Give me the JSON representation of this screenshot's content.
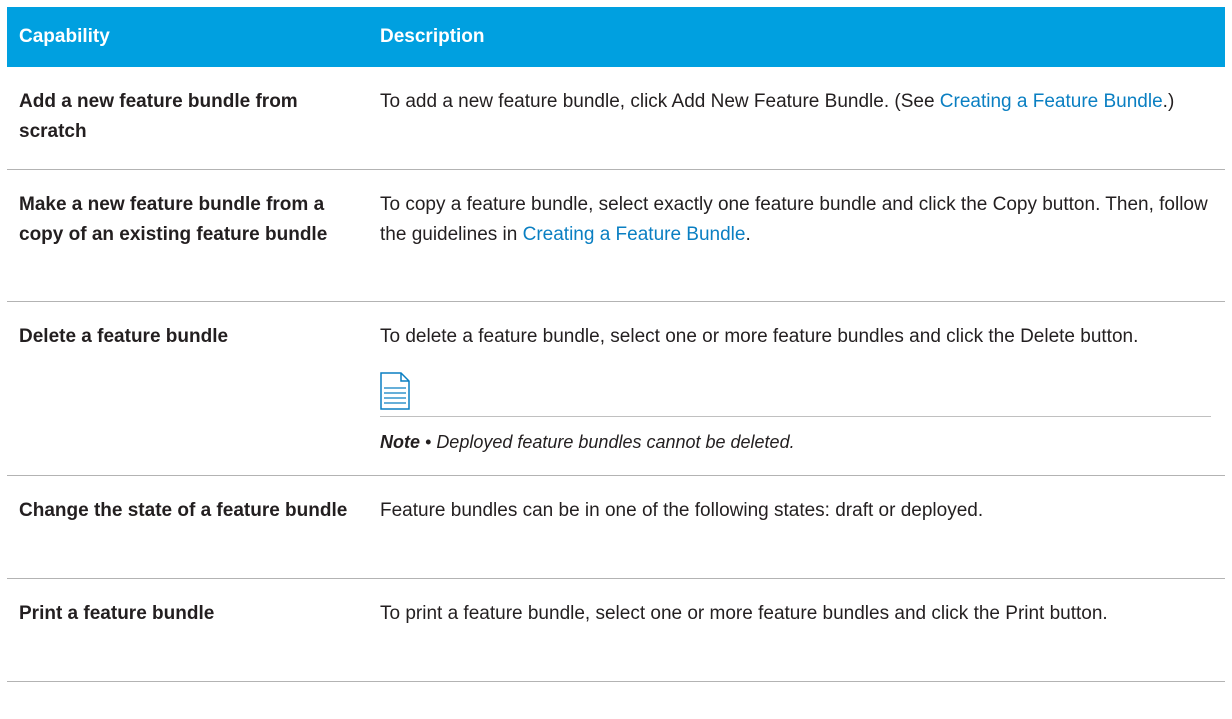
{
  "table": {
    "headers": [
      "Capability",
      "Description"
    ],
    "rows": [
      {
        "capability": "Add a new feature bundle from scratch",
        "desc_before": "To add a new feature bundle, click Add New Feature Bundle. (See ",
        "desc_link": "Creating a Feature Bundle",
        "desc_after": ".)"
      },
      {
        "capability": "Make a new feature bundle from a copy of an existing feature bundle",
        "desc_before": "To copy a feature bundle, select exactly one feature bundle and click the Copy button. Then, follow the guidelines in ",
        "desc_link": "Creating a Feature Bundle",
        "desc_after": "."
      },
      {
        "capability": "Delete a feature bundle",
        "desc": "To delete a feature bundle, select one or more feature bundles and click the Delete button.",
        "note_icon": "note-document-icon",
        "note_label": "Note",
        "note_separator": " • ",
        "note_text": "Deployed feature bundles cannot be deleted."
      },
      {
        "capability": "Change the state of a feature bundle",
        "desc": "Feature bundles can be in one of the following states: draft or deployed."
      },
      {
        "capability": "Print a feature bundle",
        "desc": "To print a feature bundle, select one or more feature bundles and click the Print button."
      }
    ]
  },
  "colors": {
    "header_bg": "#00a0e0",
    "link": "#0a7fc2"
  }
}
